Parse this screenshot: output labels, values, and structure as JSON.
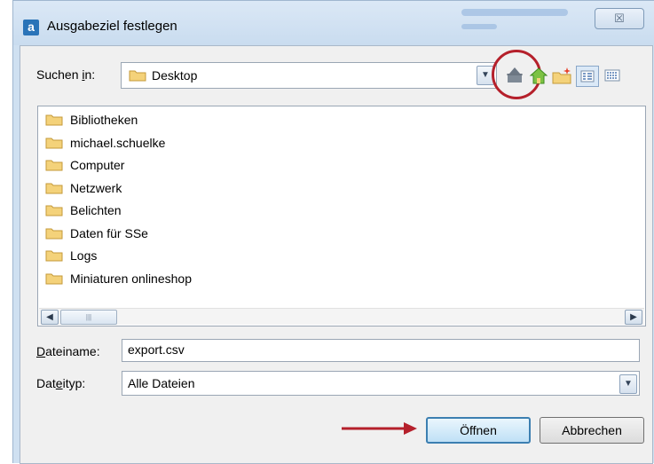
{
  "window": {
    "title": "Ausgabeziel festlegen",
    "app_icon_letter": "a",
    "close_symbol": "☒"
  },
  "look_in": {
    "label_pre": "Suchen ",
    "label_key": "i",
    "label_post": "n:",
    "value": "Desktop"
  },
  "toolbar": {
    "icons": [
      "up-one-level-icon",
      "home-icon",
      "new-folder-icon",
      "list-view-icon",
      "details-view-icon"
    ],
    "highlight_color": "#b5202b"
  },
  "files": [
    "Bibliotheken",
    "michael.schuelke",
    "Computer",
    "Netzwerk",
    "Belichten",
    "Daten für SSe",
    "Logs",
    "Miniaturen onlineshop"
  ],
  "filename": {
    "label_key": "D",
    "label_rest": "ateiname:",
    "value": "export.csv"
  },
  "filetype": {
    "label_pre": "Dat",
    "label_key": "e",
    "label_post": "ityp:",
    "value": "Alle Dateien"
  },
  "buttons": {
    "open": "Öffnen",
    "cancel": "Abbrechen"
  },
  "colors": {
    "dialog_bg": "#f0f0f0",
    "arrow": "#b5202b",
    "primary_border": "#3c7fb1"
  }
}
